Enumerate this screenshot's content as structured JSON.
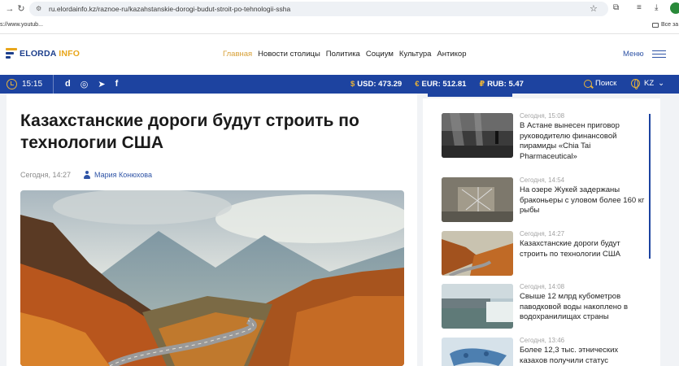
{
  "browser": {
    "url": "ru.elordainfo.kz/raznoe-ru/kazahstanskie-dorogi-budut-stroit-po-tehnologii-ssha",
    "bookmark_left": "s://www.youtub...",
    "bookmark_right": "Все за"
  },
  "site": {
    "logo_a": "ELORDA",
    "logo_b": "INFO",
    "nav": [
      {
        "label": "Главная",
        "active": true
      },
      {
        "label": "Новости столицы",
        "active": false
      },
      {
        "label": "Политика",
        "active": false
      },
      {
        "label": "Социум",
        "active": false
      },
      {
        "label": "Культура",
        "active": false
      },
      {
        "label": "Антикор",
        "active": false
      }
    ],
    "menu_label": "Меню"
  },
  "topbar": {
    "time": "15:15",
    "social": [
      "d",
      "◎",
      "➤",
      "f"
    ],
    "rates": [
      {
        "symbol": "$",
        "label": "USD: 473.29"
      },
      {
        "symbol": "€",
        "label": "EUR: 512.81"
      },
      {
        "symbol": "₽",
        "label": "RUB: 5.47"
      }
    ],
    "search_label": "Поиск",
    "lang": "KZ"
  },
  "article": {
    "title": "Казахстанские дороги будут строить по технологии США",
    "date": "Сегодня, 14:27",
    "author": "Мария Конюхова"
  },
  "sidebar": {
    "news": [
      {
        "time": "Сегодня, 15:08",
        "headline": "В Астане вынесен приговор руководителю финансовой пирамиды «Chia Tai Pharmaceutical»"
      },
      {
        "time": "Сегодня, 14:54",
        "headline": "На озере Жукей задержаны браконьеры с уловом более 160 кг рыбы"
      },
      {
        "time": "Сегодня, 14:27",
        "headline": "Казахстанские дороги будут строить по технологии США"
      },
      {
        "time": "Сегодня, 14:08",
        "headline": "Свыше 12 млрд кубометров паводковой воды накоплено в водохранилищах страны"
      },
      {
        "time": "Сегодня, 13:46",
        "headline": "Более 12,3 тыс. этнических казахов получили статус"
      }
    ]
  },
  "colors": {
    "brand_blue": "#1d43a0",
    "accent_gold": "#e8b33a",
    "nav_active": "#d7a037"
  }
}
